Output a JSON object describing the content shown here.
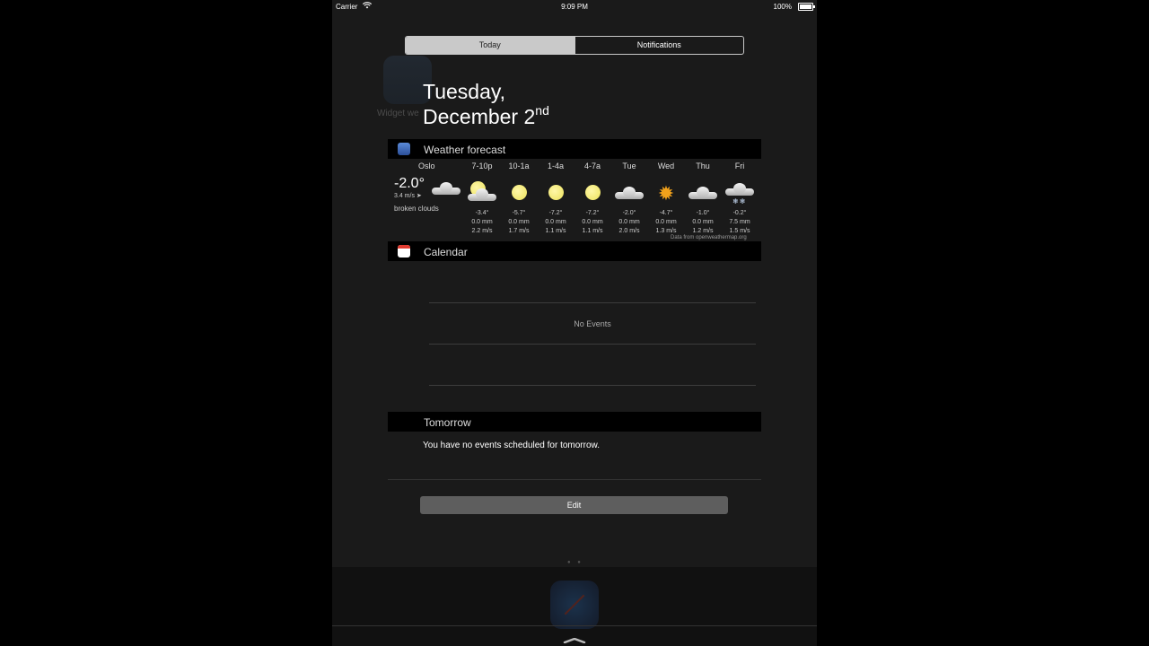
{
  "status_bar": {
    "carrier": "Carrier",
    "time": "9:09 PM",
    "battery": "100%"
  },
  "background": {
    "app_label": "Widget we"
  },
  "tabs": {
    "today": "Today",
    "notifications": "Notifications"
  },
  "date": {
    "weekday": "Tuesday,",
    "month_day": "December 2",
    "suffix": "nd"
  },
  "weather": {
    "header": "Weather forecast",
    "location": "Oslo",
    "current_temp": "-2.0°",
    "current_wind": "3.4 m/s",
    "description": "broken clouds",
    "attribution": "Data from openweathermap.org",
    "forecast": [
      {
        "label": "7-10p",
        "icon": "partly-cloudy-icon",
        "temp": "-3.4°",
        "precip": "0.0 mm",
        "wind": "2.2 m/s"
      },
      {
        "label": "10-1a",
        "icon": "clear-moon-icon",
        "temp": "-5.7°",
        "precip": "0.0 mm",
        "wind": "1.7 m/s"
      },
      {
        "label": "1-4a",
        "icon": "clear-moon-icon",
        "temp": "-7.2°",
        "precip": "0.0 mm",
        "wind": "1.1 m/s"
      },
      {
        "label": "4-7a",
        "icon": "clear-moon-icon",
        "temp": "-7.2°",
        "precip": "0.0 mm",
        "wind": "1.1 m/s"
      },
      {
        "label": "Tue",
        "icon": "cloud-icon",
        "temp": "-2.0°",
        "precip": "0.0 mm",
        "wind": "2.0 m/s"
      },
      {
        "label": "Wed",
        "icon": "sun-icon",
        "temp": "-4.7°",
        "precip": "0.0 mm",
        "wind": "1.3 m/s"
      },
      {
        "label": "Thu",
        "icon": "cloud-icon",
        "temp": "-1.0°",
        "precip": "0.0 mm",
        "wind": "1.2 m/s"
      },
      {
        "label": "Fri",
        "icon": "snow-cloud-icon",
        "temp": "-0.2°",
        "precip": "7.5 mm",
        "wind": "1.5 m/s"
      }
    ]
  },
  "calendar": {
    "header": "Calendar",
    "no_events": "No Events"
  },
  "tomorrow": {
    "header": "Tomorrow",
    "text": "You have no events scheduled for tomorrow."
  },
  "edit_button": "Edit"
}
